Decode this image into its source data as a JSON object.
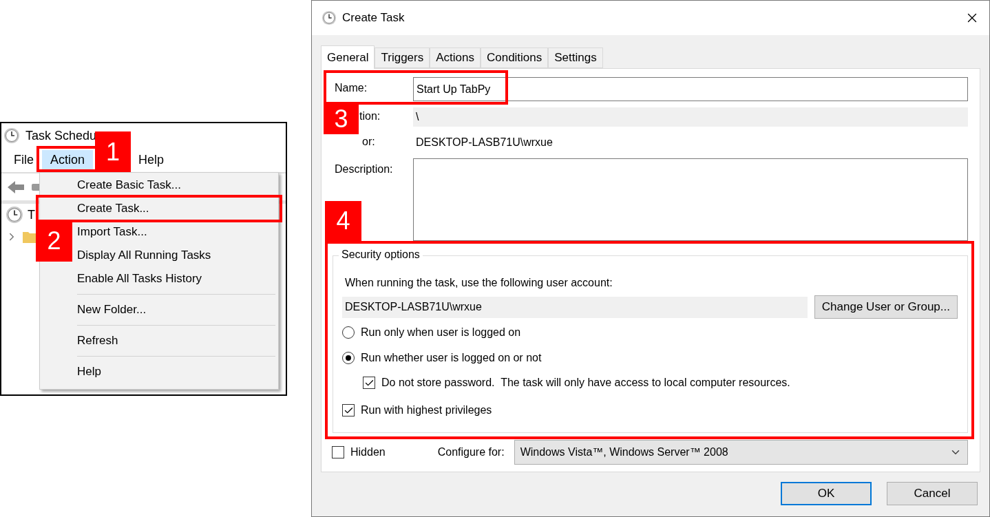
{
  "task_scheduler": {
    "title": "Task Schedu",
    "menu": [
      {
        "label": "File",
        "selected": false
      },
      {
        "label": "Action",
        "selected": true
      },
      {
        "label": "Help",
        "selected": false
      }
    ],
    "tree": [
      {
        "label": "T"
      }
    ],
    "action_menu": [
      [
        {
          "label": "Create Basic Task..."
        },
        {
          "label": "Create Task..."
        },
        {
          "label": "Import Task..."
        },
        {
          "label": "Display All Running Tasks"
        },
        {
          "label": "Enable All Tasks History"
        }
      ],
      [
        {
          "label": "New Folder..."
        }
      ],
      [
        {
          "label": "Refresh"
        }
      ],
      [
        {
          "label": "Help"
        }
      ]
    ]
  },
  "create_task": {
    "title": "Create Task",
    "tabs": [
      {
        "label": "General",
        "selected": true
      },
      {
        "label": "Triggers",
        "selected": false
      },
      {
        "label": "Actions",
        "selected": false
      },
      {
        "label": "Conditions",
        "selected": false
      },
      {
        "label": "Settings",
        "selected": false
      }
    ],
    "name_label": "Name:",
    "name": "Start Up TabPy",
    "location_label": "tion:",
    "location": "\\",
    "author_label": "or:",
    "author": "DESKTOP-LASB71U\\wrxue",
    "description_label": "Description:",
    "security": {
      "legend": "Security options",
      "prompt": "When running the task, use the following user account:",
      "account": "DESKTOP-LASB71U\\wrxue",
      "change_button": "Change User or Group...",
      "run_modes": [
        {
          "label": "Run only when user is logged on",
          "selected": false
        },
        {
          "label": "Run whether user is logged on or not",
          "selected": true
        }
      ],
      "no_password": {
        "label": "Do not store password.  The task will only have access to local computer resources.",
        "checked": true
      },
      "highest": {
        "label": "Run with highest privileges",
        "checked": true
      }
    },
    "hidden": {
      "label": "Hidden",
      "checked": false
    },
    "configure_label": "Configure for:",
    "configure_value": "Windows Vista™, Windows Server™ 2008",
    "buttons": [
      {
        "label": "OK",
        "default": true
      },
      {
        "label": "Cancel",
        "default": false
      }
    ]
  },
  "annotations": [
    {
      "label": "1"
    },
    {
      "label": "2"
    },
    {
      "label": "3"
    },
    {
      "label": "4"
    }
  ]
}
